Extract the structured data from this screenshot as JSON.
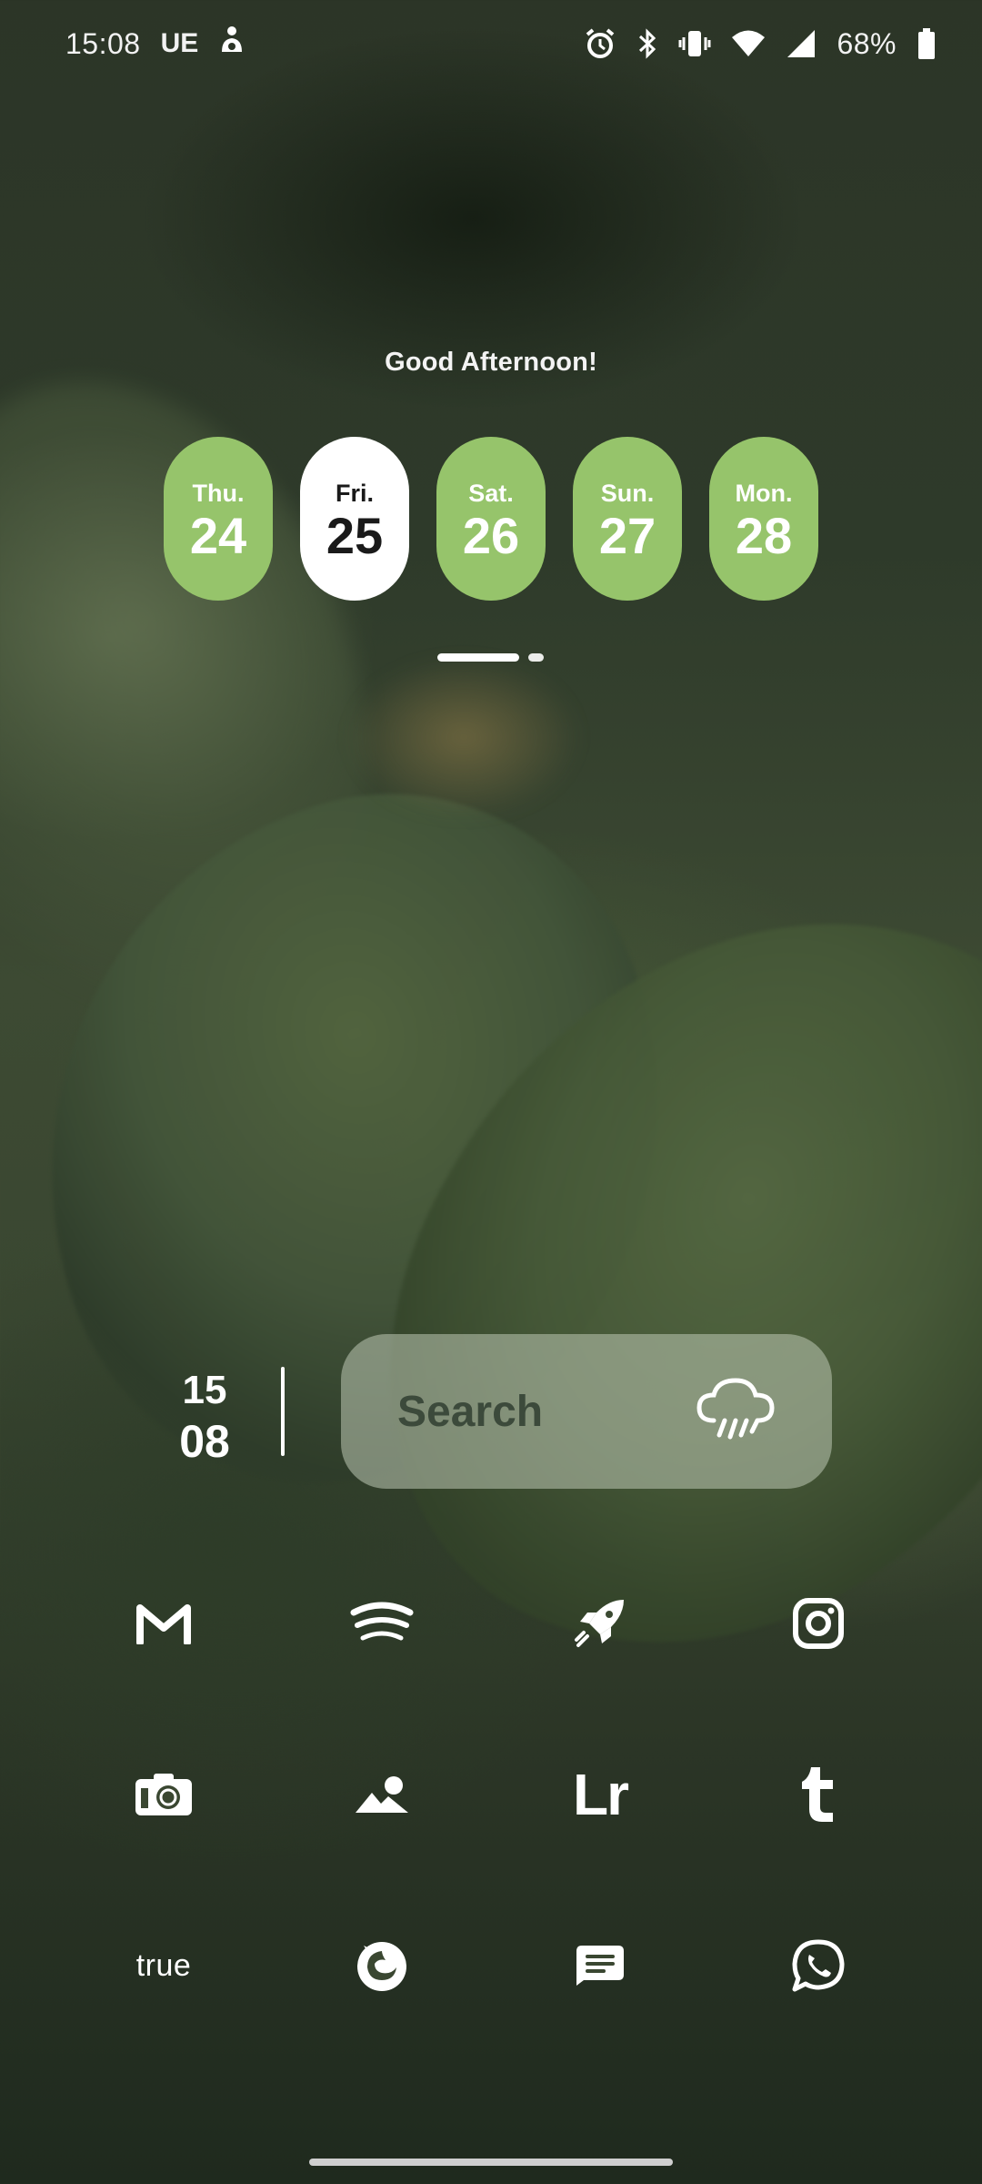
{
  "status_bar": {
    "time": "15:08",
    "carrier": "UE",
    "battery": "68%",
    "icons": [
      "notification-icon",
      "alarm-icon",
      "bluetooth-icon",
      "vibrate-icon",
      "wifi-icon",
      "signal-icon",
      "battery-icon"
    ]
  },
  "greeting": "Good Afternoon!",
  "days": [
    {
      "name": "Thu.",
      "num": "24",
      "selected": false
    },
    {
      "name": "Fri.",
      "num": "25",
      "selected": true
    },
    {
      "name": "Sat.",
      "num": "26",
      "selected": false
    },
    {
      "name": "Sun.",
      "num": "27",
      "selected": false
    },
    {
      "name": "Mon.",
      "num": "28",
      "selected": false
    }
  ],
  "accent_color": "#96c46b",
  "clock": {
    "hour": "15",
    "minute": "08"
  },
  "search": {
    "label": "Search",
    "weather_icon": "rain-cloud-icon"
  },
  "apps": [
    {
      "name": "gmail-icon"
    },
    {
      "name": "spotify-icon"
    },
    {
      "name": "rocket-icon"
    },
    {
      "name": "instagram-icon"
    },
    {
      "name": "camera-icon"
    },
    {
      "name": "gallery-icon"
    },
    {
      "name": "lightroom-icon",
      "label": "Lr"
    },
    {
      "name": "tumblr-icon"
    },
    {
      "name": "true-icon",
      "label": "true"
    },
    {
      "name": "firefox-icon"
    },
    {
      "name": "messages-icon"
    },
    {
      "name": "whatsapp-icon"
    }
  ]
}
